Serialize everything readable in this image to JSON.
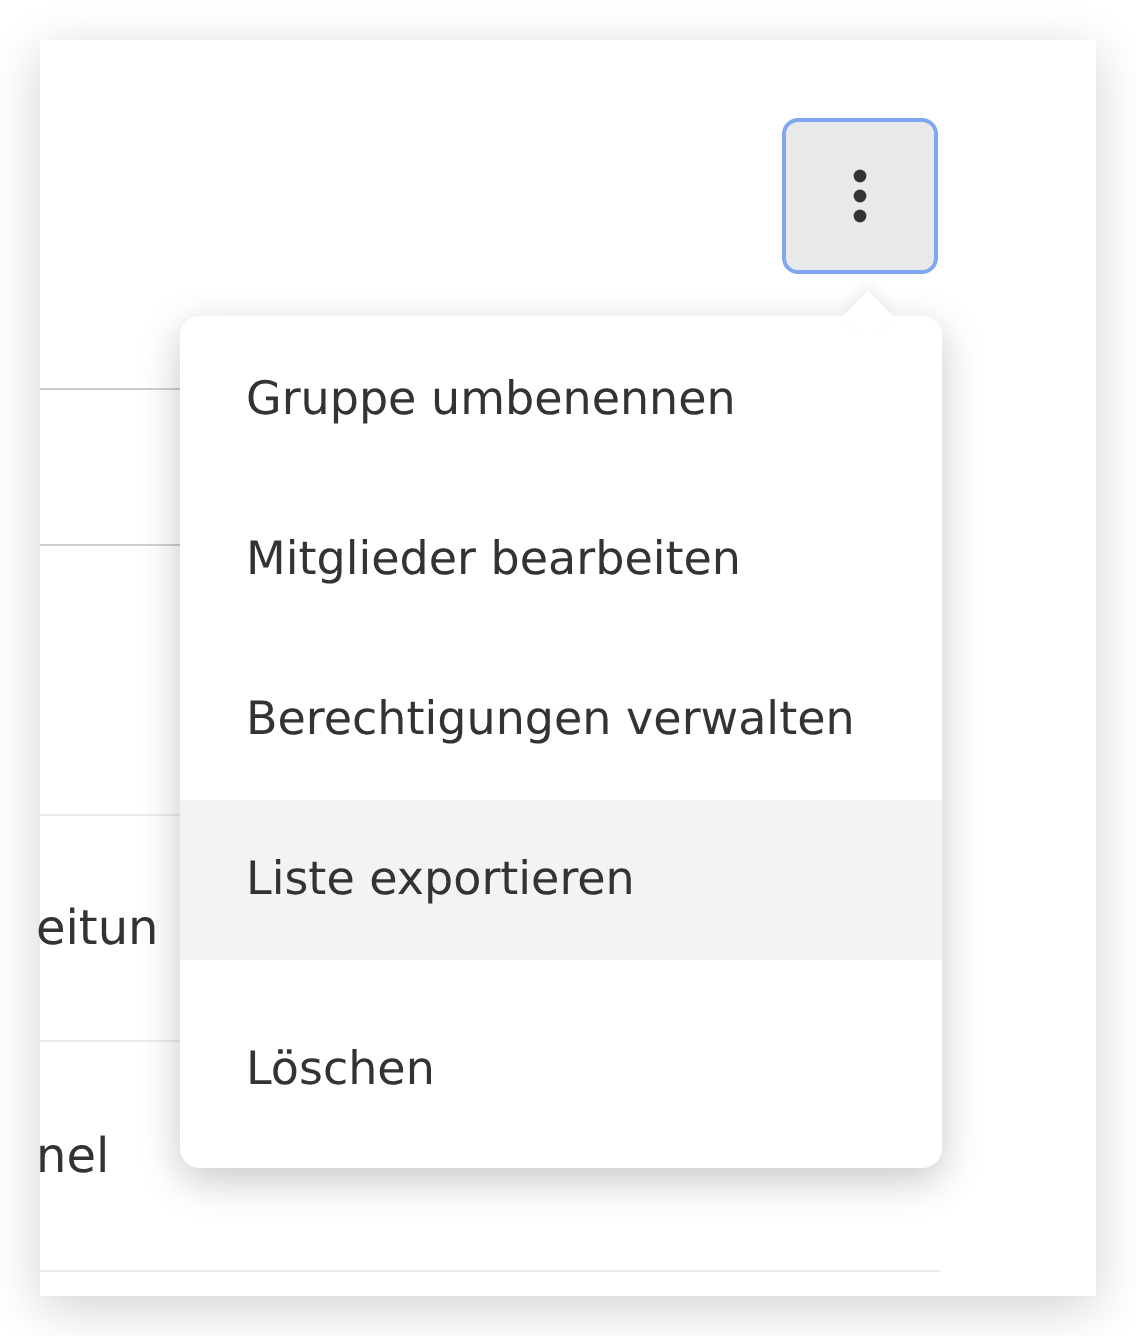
{
  "menu_button": {
    "active": true
  },
  "rows": [
    {
      "text": "eitun"
    },
    {
      "text": "nel"
    }
  ],
  "menu": {
    "items": [
      {
        "label": "Gruppe umbenennen",
        "selected": false
      },
      {
        "label": "Mitglieder bearbeiten",
        "selected": false
      },
      {
        "label": "Berechtigungen verwalten",
        "selected": false
      },
      {
        "label": "Liste exportieren",
        "selected": true
      },
      {
        "label": "Löschen",
        "selected": false
      }
    ]
  }
}
